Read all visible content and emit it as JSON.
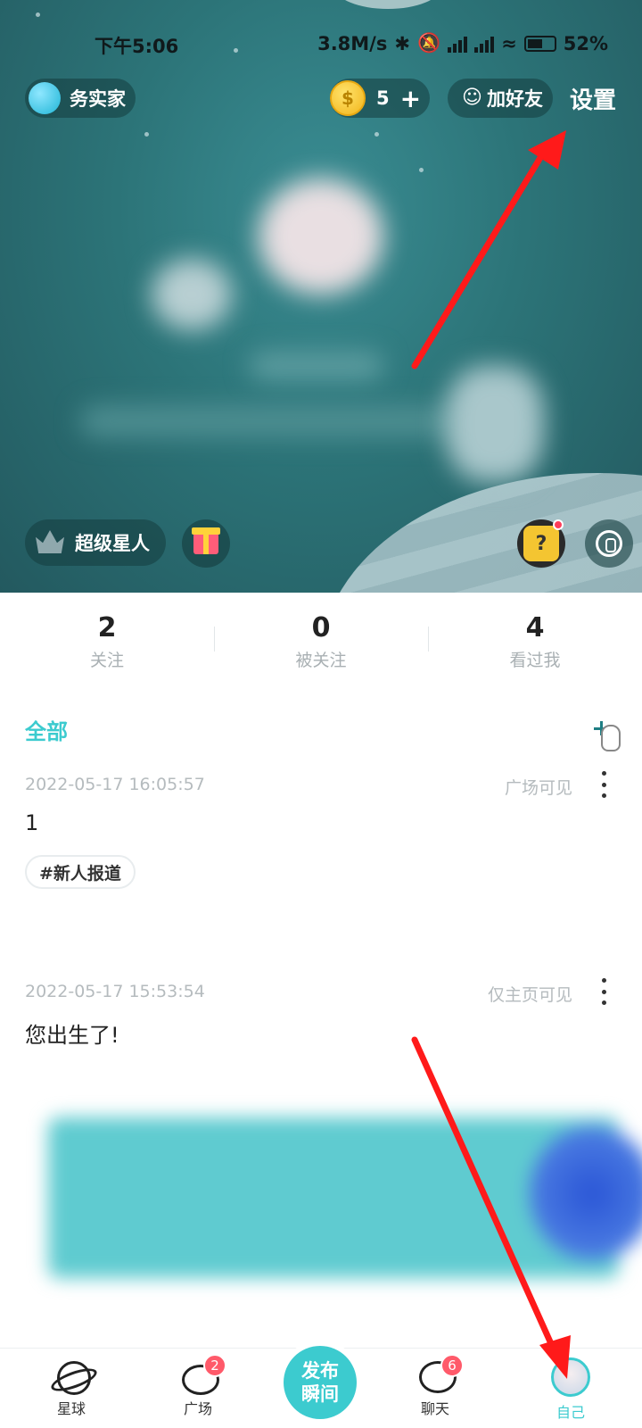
{
  "status_bar": {
    "time": "下午5:06",
    "network_speed": "3.8M/s",
    "battery": "52%"
  },
  "header": {
    "username": "务实家",
    "coins": "5",
    "add_friend_label": "加好友",
    "settings_label": "设置",
    "vip_label": "超级星人"
  },
  "stats": [
    {
      "count": "2",
      "label": "关注"
    },
    {
      "count": "0",
      "label": "被关注"
    },
    {
      "count": "4",
      "label": "看过我"
    }
  ],
  "feed": {
    "filter_label": "全部",
    "posts": [
      {
        "datetime": "2022-05-17 16:05:57",
        "visibility": "广场可见",
        "content": "1",
        "tag": "#新人报道"
      },
      {
        "datetime": "2022-05-17 15:53:54",
        "visibility": "仅主页可见",
        "content": "您出生了!"
      }
    ]
  },
  "bottom_nav": {
    "items": [
      {
        "label": "星球",
        "icon": "planet-icon"
      },
      {
        "label": "广场",
        "icon": "square-icon",
        "badge": "2"
      },
      {
        "label": "聊天",
        "icon": "chat-icon",
        "badge": "6"
      },
      {
        "label": "自己",
        "icon": "avatar-icon",
        "active": true
      }
    ],
    "publish_line1": "发布",
    "publish_line2": "瞬间"
  },
  "colors": {
    "accent": "#3ccbcf",
    "hero_bg": "#2c7478",
    "badge": "#ff5a6a",
    "annotation_arrow": "#ff1a1a"
  }
}
